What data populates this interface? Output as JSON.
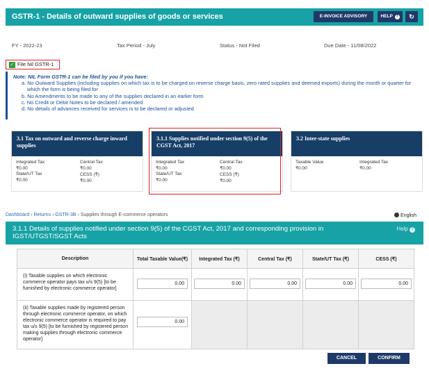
{
  "summary": {
    "title": "GSTR-1 - Details of outward supplies of goods or services",
    "einvoice_label": "E-INVOICE ADVISORY",
    "help_label": "HELP",
    "help_icon": "?",
    "refresh_icon": "↻",
    "fy": "FY - 2022-23",
    "tax_period": "Tax Period - July",
    "status": "Status - Not Filed",
    "due_date": "Due Date - 11/08/2022",
    "nil_label": "File Nil GSTR-1",
    "nil_checked": true,
    "note_title": "Note: NIL Form GSTR-1 can be filed by you if you have:",
    "note_items": [
      "a. No Outward Supplies (including supplies on which tax is to be charged on reverse charge basis, zero rated supplies and deemed exports) during the month or quarter for which the form is being filed for",
      "b. No Amendments to be made to any of the supplies declared in an earlier form",
      "c. No Credit or Debit Notes to be declared / amended",
      "d. No details of advances received for services is to be declared or adjusted"
    ]
  },
  "cards": [
    {
      "title": "3.1 Tax on outward and reverse charge inward supplies",
      "fields": [
        {
          "label": "Integrated Tax",
          "value": "₹0.00"
        },
        {
          "label": "Central Tax",
          "value": "₹0.00"
        },
        {
          "label": "State/UT Tax",
          "value": "₹0.00"
        },
        {
          "label": "CESS (₹)",
          "value": "₹0.00"
        }
      ]
    },
    {
      "title": "3.1.1 Supplies notified under section 9(5) of the CGST Act, 2017",
      "fields": [
        {
          "label": "Integrated Tax",
          "value": "₹0.00"
        },
        {
          "label": "Central Tax",
          "value": "₹0.00"
        },
        {
          "label": "State/UT Tax",
          "value": "₹0.00"
        },
        {
          "label": "CESS (₹)",
          "value": "₹0.00"
        }
      ]
    },
    {
      "title": "3.2 Inter-state supplies",
      "fields": [
        {
          "label": "Taxable Value",
          "value": "₹0.00"
        },
        {
          "label": "Integrated Tax",
          "value": "₹0.00"
        }
      ]
    }
  ],
  "detail": {
    "breadcrumb": [
      "Dashboard",
      "Returns",
      "GSTR-3B",
      "Supplies through E-commerce operators"
    ],
    "breadcrumb_sep": "›",
    "language": "English",
    "section_title": "3.1.1 Details of supplies notified under section 9(5) of the CGST Act, 2017 and corresponding provision in IGST/UTGST/SGST Acts",
    "help_label": "Help",
    "help_icon": "?",
    "columns": [
      "Description",
      "Total Taxable Value(₹)",
      "Integrated Tax (₹)",
      "Central Tax (₹)",
      "State/UT Tax (₹)",
      "CESS (₹)"
    ],
    "rows": [
      {
        "description": "(i) Taxable supplies on which electronic commerce operator pays tax u/s 9(5) [to be furnished by electronic commerce operator]",
        "values": [
          "0.00",
          "0.00",
          "0.00",
          "0.00",
          "0.00"
        ]
      },
      {
        "description": "(ii) Taxable supplies made by registered person through electronic commerce operator, on which electronic commerce operator is required to pay tax u/s 9(5) [to be furnished by registered person making supplies through electronic commerce operator]",
        "values": [
          "0.00"
        ]
      }
    ],
    "cancel_label": "CANCEL",
    "confirm_label": "CONFIRM"
  }
}
